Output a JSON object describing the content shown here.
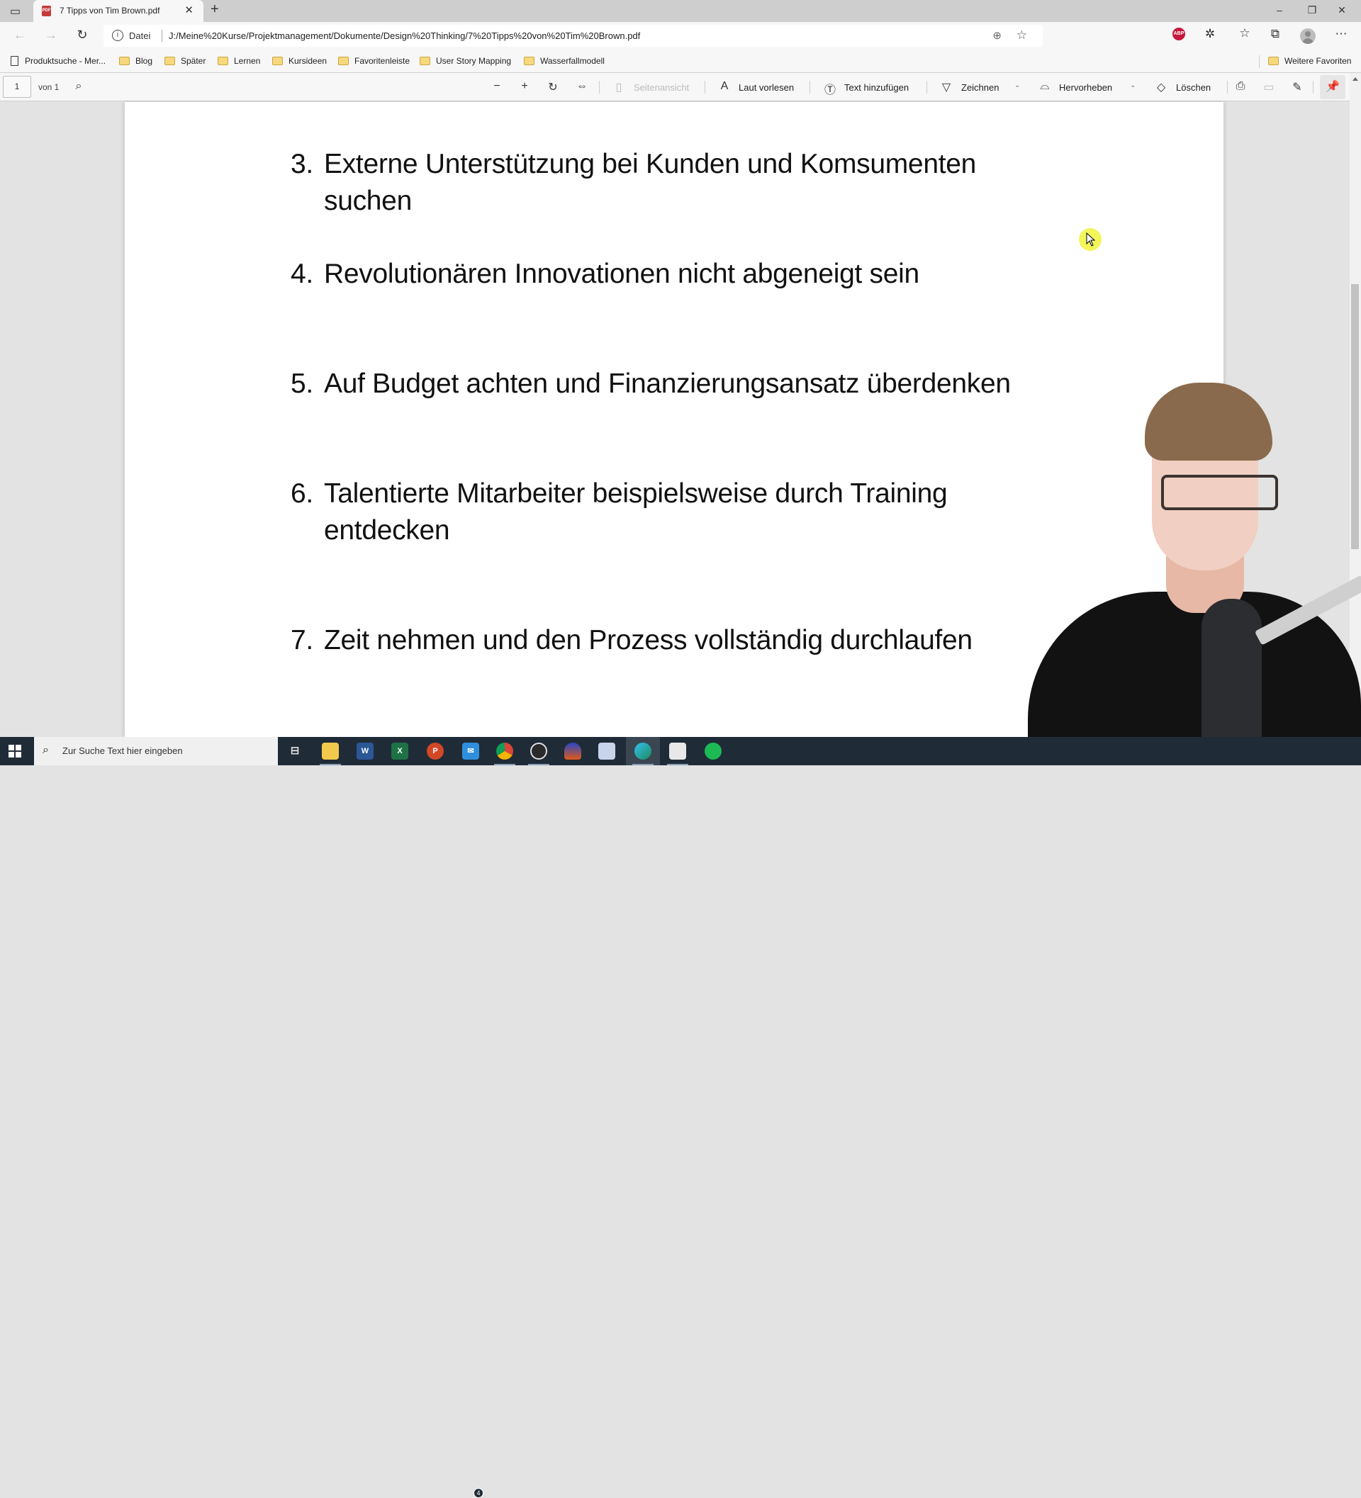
{
  "browser": {
    "tab": {
      "title": "7 Tipps von Tim Brown.pdf",
      "icon": "pdf-icon"
    },
    "window_controls": {
      "minimize": "–",
      "restore": "❐",
      "close": "✕"
    },
    "address": {
      "scheme_label": "Datei",
      "url": "J:/Meine%20Kurse/Projektmanagement/Dokumente/Design%20Thinking/7%20Tipps%20von%20Tim%20Brown.pdf"
    },
    "extensions": {
      "adblock_label": "ABP"
    },
    "bookmarks": [
      {
        "label": "Produktsuche - Mer...",
        "type": "page"
      },
      {
        "label": "Blog",
        "type": "folder"
      },
      {
        "label": "Später",
        "type": "folder"
      },
      {
        "label": "Lernen",
        "type": "folder"
      },
      {
        "label": "Kursideen",
        "type": "folder"
      },
      {
        "label": "Favoritenleiste",
        "type": "folder"
      },
      {
        "label": "User Story Mapping",
        "type": "folder"
      },
      {
        "label": "Wasserfallmodell",
        "type": "folder"
      }
    ],
    "other_favorites": "Weitere Favoriten"
  },
  "pdf_toolbar": {
    "page_number": "1",
    "page_count": "von 1",
    "page_view": "Seitenansicht",
    "read_aloud": "Laut vorlesen",
    "add_text": "Text hinzufügen",
    "draw": "Zeichnen",
    "highlight": "Hervorheben",
    "erase": "Löschen"
  },
  "document": {
    "tips": [
      {
        "num": "3.",
        "text": "Externe Unterstützung bei Kunden und Komsumenten suchen"
      },
      {
        "num": "4.",
        "text": "Revolutionären Innovationen nicht abgeneigt sein"
      },
      {
        "num": "5.",
        "text": "Auf Budget achten und Finanzierungsansatz überdenken"
      },
      {
        "num": "6.",
        "text": "Talentierte Mitarbeiter beispielsweise durch Training entdecken"
      },
      {
        "num": "7.",
        "text": "Zeit nehmen und den Prozess vollständig durchlaufen"
      }
    ]
  },
  "taskbar": {
    "search_placeholder": "Zur Suche Text hier eingeben",
    "mail_badge": "4",
    "apps": [
      "task-view",
      "file-explorer",
      "word",
      "excel",
      "powerpoint",
      "mail",
      "chrome",
      "obs",
      "audacity",
      "paint-app",
      "edge",
      "notepad-app",
      "spotify"
    ]
  },
  "colors": {
    "abp_red": "#c4183c",
    "taskbar_bg": "#202b38",
    "cursor_highlight": "#f0f53c"
  }
}
